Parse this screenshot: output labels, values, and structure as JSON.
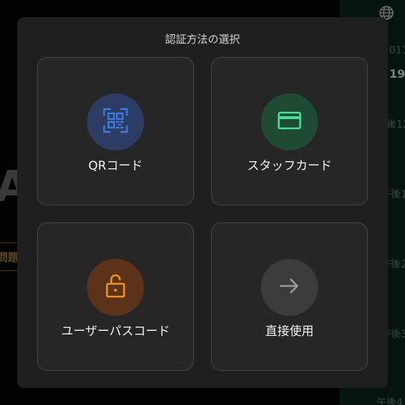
{
  "background": {
    "labels": [
      "011",
      "19",
      "後12",
      "午後1",
      "午後2",
      "午後3",
      "午後4"
    ],
    "issue_label": "問題"
  },
  "modal": {
    "title": "認証方法の選択",
    "options": [
      {
        "label": "QRコード",
        "icon": "qr-scan-icon",
        "color": "#3d7be0"
      },
      {
        "label": "スタッフカード",
        "icon": "card-icon",
        "color": "#4ade9a"
      },
      {
        "label": "ユーザーパスコード",
        "icon": "unlock-icon",
        "color": "#f39220"
      },
      {
        "label": "直接使用",
        "icon": "arrow-right-icon",
        "color": "#9a9a9a"
      }
    ]
  },
  "colors": {
    "modal_bg": "#1f1f1f",
    "card_bg": "#262626",
    "card_border": "#474747",
    "qr_circle": "#2c3c63",
    "card_circle": "#1f4a33",
    "lock_circle": "#5a3318",
    "arrow_circle": "#3c3c3c"
  }
}
